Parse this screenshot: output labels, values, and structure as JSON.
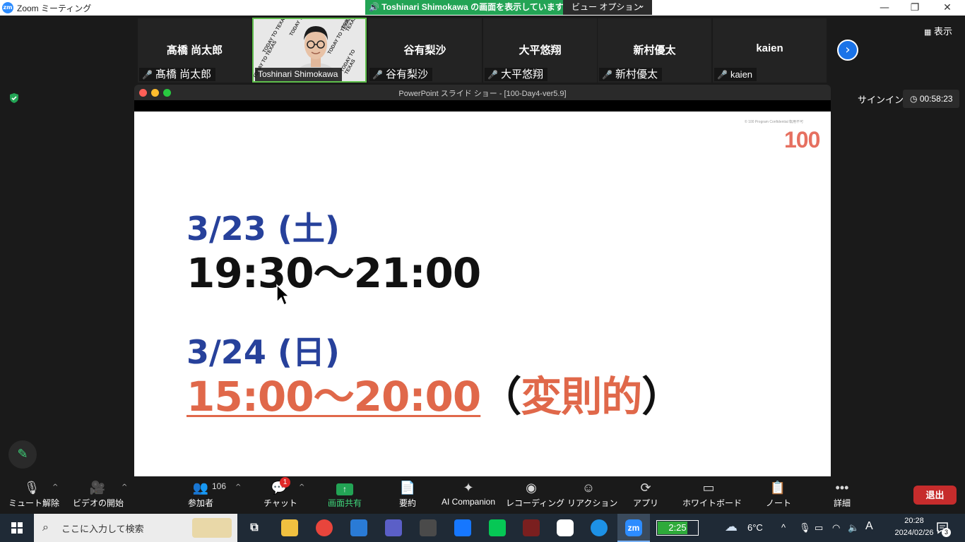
{
  "window": {
    "app_title": "Zoom ミーティング",
    "logo_text": "zm",
    "minimize": "—",
    "restore": "❐",
    "close": "✕"
  },
  "share_banner": {
    "text": "Toshinari  Shimokawa の画面を表示しています",
    "view_options": "ビュー オプション",
    "view_options_caret": "⌄"
  },
  "participants": [
    {
      "display": "髙橋 尚太郎",
      "label": "髙橋 尚太郎"
    },
    {
      "display": "",
      "label": "Toshinari Shimokawa"
    },
    {
      "display": "谷有梨沙",
      "label": "谷有梨沙"
    },
    {
      "display": "大平悠翔",
      "label": "大平悠翔"
    },
    {
      "display": "新村優太",
      "label": "新村優太"
    },
    {
      "display": "kaien",
      "label": "kaien"
    }
  ],
  "video_background_text": "TODAY TO TEXAS",
  "top_right": {
    "view_label": "表示",
    "signin": "サインイン",
    "timer": "00:58:23"
  },
  "ppt": {
    "window_title": "PowerPoint スライド ショー - [100-Day4-ver5.9]",
    "confidential": "© 100 Program Confidential 転用不可",
    "logo": "100",
    "date1": "3/23 (土)",
    "time1": "19:30〜21:00",
    "date2": "3/24 (日)",
    "time2": "15:00〜20:00",
    "paren_open": "（",
    "note": "変則的",
    "paren_close": "）"
  },
  "toolbar": {
    "mute": "ミュート解除",
    "video": "ビデオの開始",
    "participants": "参加者",
    "participants_count": "106",
    "chat": "チャット",
    "chat_badge": "1",
    "share": "画面共有",
    "summary": "要約",
    "ai": "AI Companion",
    "record": "レコーディング",
    "reactions": "リアクション",
    "apps": "アプリ",
    "whiteboard": "ホワイトボード",
    "notes": "ノート",
    "more": "詳細",
    "leave": "退出"
  },
  "taskbar": {
    "search_placeholder": "ここに入力して検索",
    "battery": "2:25",
    "battery_fraction": 0.75,
    "weather": "6°C",
    "time": "20:28",
    "date": "2024/02/26",
    "ime": "A",
    "notification_count": "3"
  }
}
